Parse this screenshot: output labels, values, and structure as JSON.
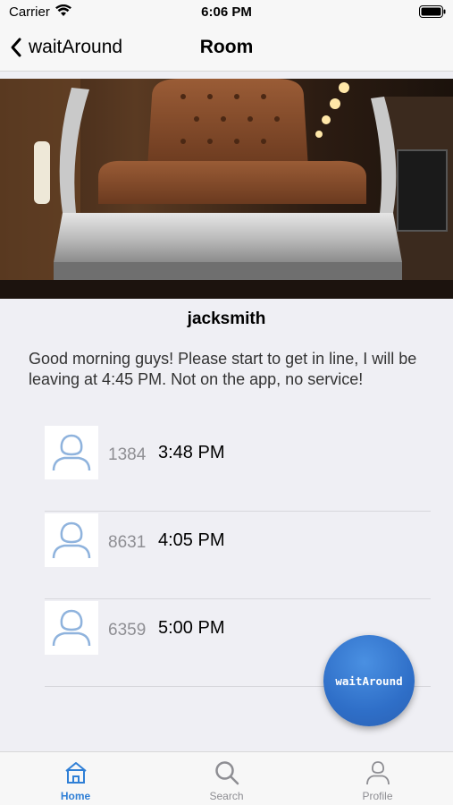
{
  "status_bar": {
    "carrier": "Carrier",
    "time": "6:06 PM"
  },
  "nav": {
    "back_label": "waitAround",
    "title": "Room"
  },
  "room": {
    "owner": "jacksmith",
    "message": "Good morning guys! Please start to get in line, I will be leaving at 4:45 PM. Not on the app, no service!"
  },
  "queue": [
    {
      "code": "1384",
      "time": "3:48 PM"
    },
    {
      "code": "8631",
      "time": "4:05 PM"
    },
    {
      "code": "6359",
      "time": "5:00 PM"
    }
  ],
  "fab": {
    "label": "waitAround"
  },
  "tabs": [
    {
      "label": "Home",
      "icon": "home-icon",
      "active": true
    },
    {
      "label": "Search",
      "icon": "search-icon",
      "active": false
    },
    {
      "label": "Profile",
      "icon": "profile-icon",
      "active": false
    }
  ],
  "colors": {
    "accent": "#2f7fd6",
    "fab": "#2f6fc8",
    "avatar_stroke": "#8fb3dd"
  }
}
